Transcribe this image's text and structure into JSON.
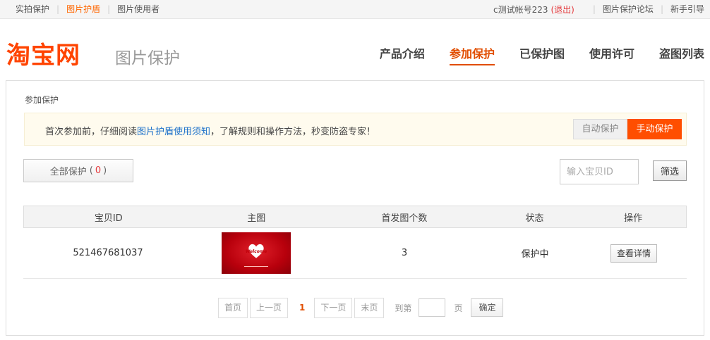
{
  "topbar": {
    "left_links": [
      "实拍保护",
      "图片护盾",
      "图片使用者"
    ],
    "active_index": 1,
    "account": "c测试帐号223",
    "logout": "(退出)",
    "right_links": [
      "图片保护论坛",
      "新手引导"
    ]
  },
  "header": {
    "logo": "淘宝网",
    "subtitle": "图片保护",
    "nav": [
      "产品介绍",
      "参加保护",
      "已保护图",
      "使用许可",
      "盗图列表"
    ],
    "nav_active_index": 1
  },
  "breadcrumb": "参加保护",
  "notice": {
    "prefix": "首次参加前，仔细阅读",
    "link": "图片护盾使用须知",
    "suffix": "，了解规则和操作方法，秒变防盗专家！",
    "auto_label": "自动保护",
    "manual_label": "手动保护"
  },
  "filter": {
    "all_label": "全部保护",
    "all_count": "0",
    "search_placeholder": "输入宝贝ID",
    "filter_button": "筛选"
  },
  "table": {
    "headers": [
      "宝贝ID",
      "主图",
      "首发图个数",
      "状态",
      "操作"
    ],
    "rows": [
      {
        "item_id": "521467681037",
        "image_text": "Welcome",
        "first_count": "3",
        "status": "保护中",
        "action": "查看详情"
      }
    ]
  },
  "pager": {
    "first": "首页",
    "prev": "上一页",
    "current": "1",
    "next": "下一页",
    "last": "末页",
    "goto": "到第",
    "unit": "页",
    "confirm": "确定"
  },
  "colors": {
    "brand": "#ff4e00",
    "nav_active": "#e14d00",
    "link": "#1a6fc9"
  }
}
